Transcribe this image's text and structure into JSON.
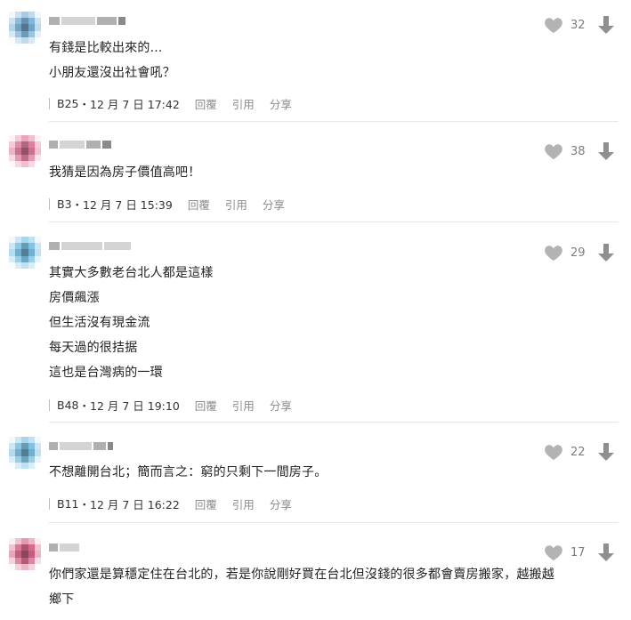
{
  "comments": [
    {
      "lines": [
        "有錢是比較出來的...",
        "小朋友還沒出社會吼？"
      ],
      "floor": "B25",
      "date": "12 月 7 日 17:42",
      "likes": "32",
      "avatar_color": "#7fb6d9"
    },
    {
      "lines": [
        "我猜是因為房子價值高吧！"
      ],
      "floor": "B3",
      "date": "12 月 7 日 15:39",
      "likes": "38",
      "avatar_color": "#e07fa0"
    },
    {
      "lines": [
        "其實大多數老台北人都是這樣",
        "房價飆漲",
        "但生活沒有現金流",
        "每天過的很拮据",
        "這也是台灣病的一環"
      ],
      "floor": "B48",
      "date": "12 月 7 日 19:10",
      "likes": "29",
      "avatar_color": "#7ec4e6"
    },
    {
      "lines": [
        "不想離開台北；簡而言之：窮的只剩下一間房子。"
      ],
      "floor": "B11",
      "date": "12 月 7 日 16:22",
      "likes": "22",
      "avatar_color": "#80c2e0"
    },
    {
      "lines": [
        "你們家還是算穩定住在台北的，若是你說剛好買在台北但沒錢的很多都會賣房搬家，越搬越",
        "鄉下"
      ],
      "floor": "",
      "date": "",
      "likes": "17",
      "avatar_color": "#d86a8c"
    }
  ],
  "actions": {
    "reply": "回覆",
    "quote": "引用",
    "share": "分享"
  },
  "date_separator": "・",
  "colors": {
    "icon_gray": "#b3b3b3",
    "arrow_gray": "#8f8f8f",
    "divider": "#e6e6e6"
  }
}
